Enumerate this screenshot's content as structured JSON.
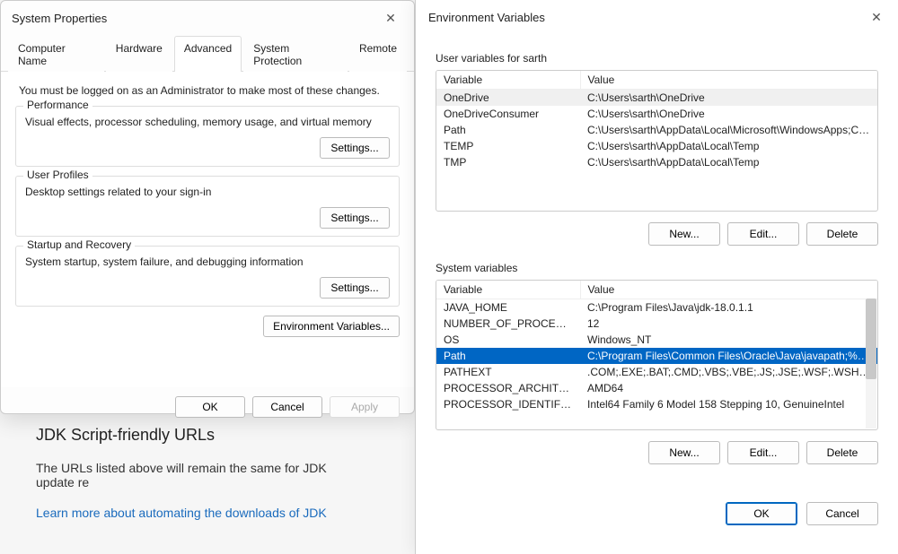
{
  "background": {
    "heading": "JDK Script-friendly URLs",
    "paragraph": "The URLs listed above will remain the same for JDK update re",
    "link_text": "Learn more about automating the downloads of JDK"
  },
  "sysprops": {
    "title": "System Properties",
    "tabs": {
      "computer_name": "Computer Name",
      "hardware": "Hardware",
      "advanced": "Advanced",
      "system_protection": "System Protection",
      "remote": "Remote"
    },
    "note": "You must be logged on as an Administrator to make most of these changes.",
    "performance": {
      "legend": "Performance",
      "desc": "Visual effects, processor scheduling, memory usage, and virtual memory",
      "button": "Settings..."
    },
    "user_profiles": {
      "legend": "User Profiles",
      "desc": "Desktop settings related to your sign-in",
      "button": "Settings..."
    },
    "startup": {
      "legend": "Startup and Recovery",
      "desc": "System startup, system failure, and debugging information",
      "button": "Settings..."
    },
    "env_button": "Environment Variables...",
    "ok": "OK",
    "cancel": "Cancel",
    "apply": "Apply"
  },
  "envwin": {
    "title": "Environment Variables",
    "user_section": "User variables for sarth",
    "system_section": "System variables",
    "headers": {
      "variable": "Variable",
      "value": "Value"
    },
    "user_vars": [
      {
        "name": "OneDrive",
        "value": "C:\\Users\\sarth\\OneDrive"
      },
      {
        "name": "OneDriveConsumer",
        "value": "C:\\Users\\sarth\\OneDrive"
      },
      {
        "name": "Path",
        "value": "C:\\Users\\sarth\\AppData\\Local\\Microsoft\\WindowsApps;C:\\Us..."
      },
      {
        "name": "TEMP",
        "value": "C:\\Users\\sarth\\AppData\\Local\\Temp"
      },
      {
        "name": "TMP",
        "value": "C:\\Users\\sarth\\AppData\\Local\\Temp"
      }
    ],
    "system_vars": [
      {
        "name": "JAVA_HOME",
        "value": "C:\\Program Files\\Java\\jdk-18.0.1.1"
      },
      {
        "name": "NUMBER_OF_PROCESSORS",
        "value": "12"
      },
      {
        "name": "OS",
        "value": "Windows_NT"
      },
      {
        "name": "Path",
        "value": "C:\\Program Files\\Common Files\\Oracle\\Java\\javapath;%C_EM..."
      },
      {
        "name": "PATHEXT",
        "value": ".COM;.EXE;.BAT;.CMD;.VBS;.VBE;.JS;.JSE;.WSF;.WSH;.MSC"
      },
      {
        "name": "PROCESSOR_ARCHITECTU...",
        "value": "AMD64"
      },
      {
        "name": "PROCESSOR_IDENTIFIER",
        "value": "Intel64 Family 6 Model 158 Stepping 10, GenuineIntel"
      }
    ],
    "buttons": {
      "new": "New...",
      "edit": "Edit...",
      "delete": "Delete",
      "ok": "OK",
      "cancel": "Cancel"
    },
    "user_vars_highlight_index": 0,
    "system_vars_selected_index": 3
  }
}
